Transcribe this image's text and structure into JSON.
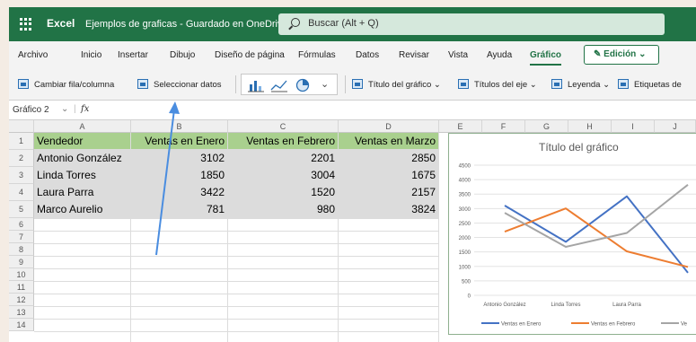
{
  "app": {
    "name": "Excel",
    "document_title": "Ejemplos de graficas - Guardado en OneDrive",
    "search_placeholder": "Buscar (Alt + Q)"
  },
  "ribbon_tabs": [
    "Archivo",
    "Inicio",
    "Insertar",
    "Dibujo",
    "Diseño de página",
    "Fórmulas",
    "Datos",
    "Revisar",
    "Vista",
    "Ayuda",
    "Gráfico"
  ],
  "active_tab": "Gráfico",
  "edit_mode": "Edición",
  "toolbar": {
    "switch_row_col": "Cambiar fila/columna",
    "select_data": "Seleccionar datos",
    "chart_title": "Título del gráfico",
    "axis_titles": "Títulos del eje",
    "legend": "Leyenda",
    "data_labels": "Etiquetas de"
  },
  "name_box": "Gráfico 2",
  "fx": "fx",
  "columns": [
    "A",
    "B",
    "C",
    "D",
    "E",
    "F",
    "G",
    "H",
    "I",
    "J"
  ],
  "rows": [
    "1",
    "2",
    "3",
    "4",
    "5",
    "6",
    "7",
    "8",
    "9",
    "10",
    "11",
    "12",
    "13",
    "14"
  ],
  "sheet": {
    "headers": [
      "Vendedor",
      "Ventas en Enero",
      "Ventas en Febrero",
      "Ventas en Marzo"
    ],
    "data": [
      [
        "Antonio González",
        "3102",
        "2201",
        "2850"
      ],
      [
        "Linda Torres",
        "1850",
        "3004",
        "1675"
      ],
      [
        "Laura Parra",
        "3422",
        "1520",
        "2157"
      ],
      [
        "Marco Aurelio",
        "781",
        "980",
        "3824"
      ]
    ]
  },
  "chart_data": {
    "type": "line",
    "title": "Título del gráfico",
    "categories": [
      "Antonio González",
      "Linda Torres",
      "Laura Parra",
      "Marco Aurelio"
    ],
    "visible_categories": [
      "Antonio González",
      "Linda Torres",
      "Laura Parra"
    ],
    "series": [
      {
        "name": "Ventas en Enero",
        "values": [
          3102,
          1850,
          3422,
          781
        ],
        "color": "#4472c4"
      },
      {
        "name": "Ventas en Febrero",
        "values": [
          2201,
          3004,
          1520,
          980
        ],
        "color": "#ed7d31"
      },
      {
        "name": "Ventas en Marzo",
        "values": [
          2850,
          1675,
          2157,
          3824
        ],
        "color": "#a5a5a5"
      }
    ],
    "legend_labels": [
      "Ventas en Enero",
      "Ventas en Febrero",
      "Ve"
    ],
    "y_ticks": [
      "0",
      "500",
      "1000",
      "1500",
      "2000",
      "2500",
      "3000",
      "3500",
      "4000",
      "4500"
    ],
    "ylim": [
      0,
      4500
    ],
    "legend_position": "bottom",
    "grid": true
  },
  "colors": {
    "brand": "#217346",
    "header_fill": "#a9d08e",
    "annotation_arrow": "#4a8de0"
  }
}
